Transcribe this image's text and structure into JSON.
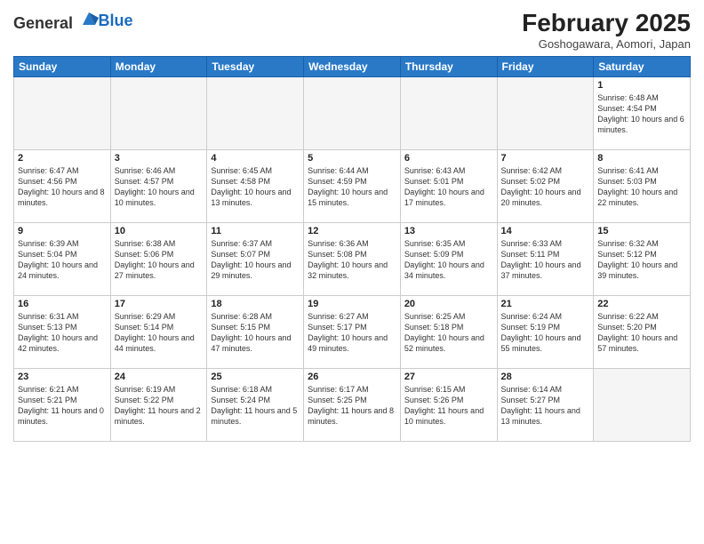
{
  "header": {
    "logo_general": "General",
    "logo_blue": "Blue",
    "month_title": "February 2025",
    "subtitle": "Goshogawara, Aomori, Japan"
  },
  "days_of_week": [
    "Sunday",
    "Monday",
    "Tuesday",
    "Wednesday",
    "Thursday",
    "Friday",
    "Saturday"
  ],
  "weeks": [
    [
      {
        "day": "",
        "info": ""
      },
      {
        "day": "",
        "info": ""
      },
      {
        "day": "",
        "info": ""
      },
      {
        "day": "",
        "info": ""
      },
      {
        "day": "",
        "info": ""
      },
      {
        "day": "",
        "info": ""
      },
      {
        "day": "1",
        "info": "Sunrise: 6:48 AM\nSunset: 4:54 PM\nDaylight: 10 hours and 6 minutes."
      }
    ],
    [
      {
        "day": "2",
        "info": "Sunrise: 6:47 AM\nSunset: 4:56 PM\nDaylight: 10 hours and 8 minutes."
      },
      {
        "day": "3",
        "info": "Sunrise: 6:46 AM\nSunset: 4:57 PM\nDaylight: 10 hours and 10 minutes."
      },
      {
        "day": "4",
        "info": "Sunrise: 6:45 AM\nSunset: 4:58 PM\nDaylight: 10 hours and 13 minutes."
      },
      {
        "day": "5",
        "info": "Sunrise: 6:44 AM\nSunset: 4:59 PM\nDaylight: 10 hours and 15 minutes."
      },
      {
        "day": "6",
        "info": "Sunrise: 6:43 AM\nSunset: 5:01 PM\nDaylight: 10 hours and 17 minutes."
      },
      {
        "day": "7",
        "info": "Sunrise: 6:42 AM\nSunset: 5:02 PM\nDaylight: 10 hours and 20 minutes."
      },
      {
        "day": "8",
        "info": "Sunrise: 6:41 AM\nSunset: 5:03 PM\nDaylight: 10 hours and 22 minutes."
      }
    ],
    [
      {
        "day": "9",
        "info": "Sunrise: 6:39 AM\nSunset: 5:04 PM\nDaylight: 10 hours and 24 minutes."
      },
      {
        "day": "10",
        "info": "Sunrise: 6:38 AM\nSunset: 5:06 PM\nDaylight: 10 hours and 27 minutes."
      },
      {
        "day": "11",
        "info": "Sunrise: 6:37 AM\nSunset: 5:07 PM\nDaylight: 10 hours and 29 minutes."
      },
      {
        "day": "12",
        "info": "Sunrise: 6:36 AM\nSunset: 5:08 PM\nDaylight: 10 hours and 32 minutes."
      },
      {
        "day": "13",
        "info": "Sunrise: 6:35 AM\nSunset: 5:09 PM\nDaylight: 10 hours and 34 minutes."
      },
      {
        "day": "14",
        "info": "Sunrise: 6:33 AM\nSunset: 5:11 PM\nDaylight: 10 hours and 37 minutes."
      },
      {
        "day": "15",
        "info": "Sunrise: 6:32 AM\nSunset: 5:12 PM\nDaylight: 10 hours and 39 minutes."
      }
    ],
    [
      {
        "day": "16",
        "info": "Sunrise: 6:31 AM\nSunset: 5:13 PM\nDaylight: 10 hours and 42 minutes."
      },
      {
        "day": "17",
        "info": "Sunrise: 6:29 AM\nSunset: 5:14 PM\nDaylight: 10 hours and 44 minutes."
      },
      {
        "day": "18",
        "info": "Sunrise: 6:28 AM\nSunset: 5:15 PM\nDaylight: 10 hours and 47 minutes."
      },
      {
        "day": "19",
        "info": "Sunrise: 6:27 AM\nSunset: 5:17 PM\nDaylight: 10 hours and 49 minutes."
      },
      {
        "day": "20",
        "info": "Sunrise: 6:25 AM\nSunset: 5:18 PM\nDaylight: 10 hours and 52 minutes."
      },
      {
        "day": "21",
        "info": "Sunrise: 6:24 AM\nSunset: 5:19 PM\nDaylight: 10 hours and 55 minutes."
      },
      {
        "day": "22",
        "info": "Sunrise: 6:22 AM\nSunset: 5:20 PM\nDaylight: 10 hours and 57 minutes."
      }
    ],
    [
      {
        "day": "23",
        "info": "Sunrise: 6:21 AM\nSunset: 5:21 PM\nDaylight: 11 hours and 0 minutes."
      },
      {
        "day": "24",
        "info": "Sunrise: 6:19 AM\nSunset: 5:22 PM\nDaylight: 11 hours and 2 minutes."
      },
      {
        "day": "25",
        "info": "Sunrise: 6:18 AM\nSunset: 5:24 PM\nDaylight: 11 hours and 5 minutes."
      },
      {
        "day": "26",
        "info": "Sunrise: 6:17 AM\nSunset: 5:25 PM\nDaylight: 11 hours and 8 minutes."
      },
      {
        "day": "27",
        "info": "Sunrise: 6:15 AM\nSunset: 5:26 PM\nDaylight: 11 hours and 10 minutes."
      },
      {
        "day": "28",
        "info": "Sunrise: 6:14 AM\nSunset: 5:27 PM\nDaylight: 11 hours and 13 minutes."
      },
      {
        "day": "",
        "info": ""
      }
    ]
  ]
}
